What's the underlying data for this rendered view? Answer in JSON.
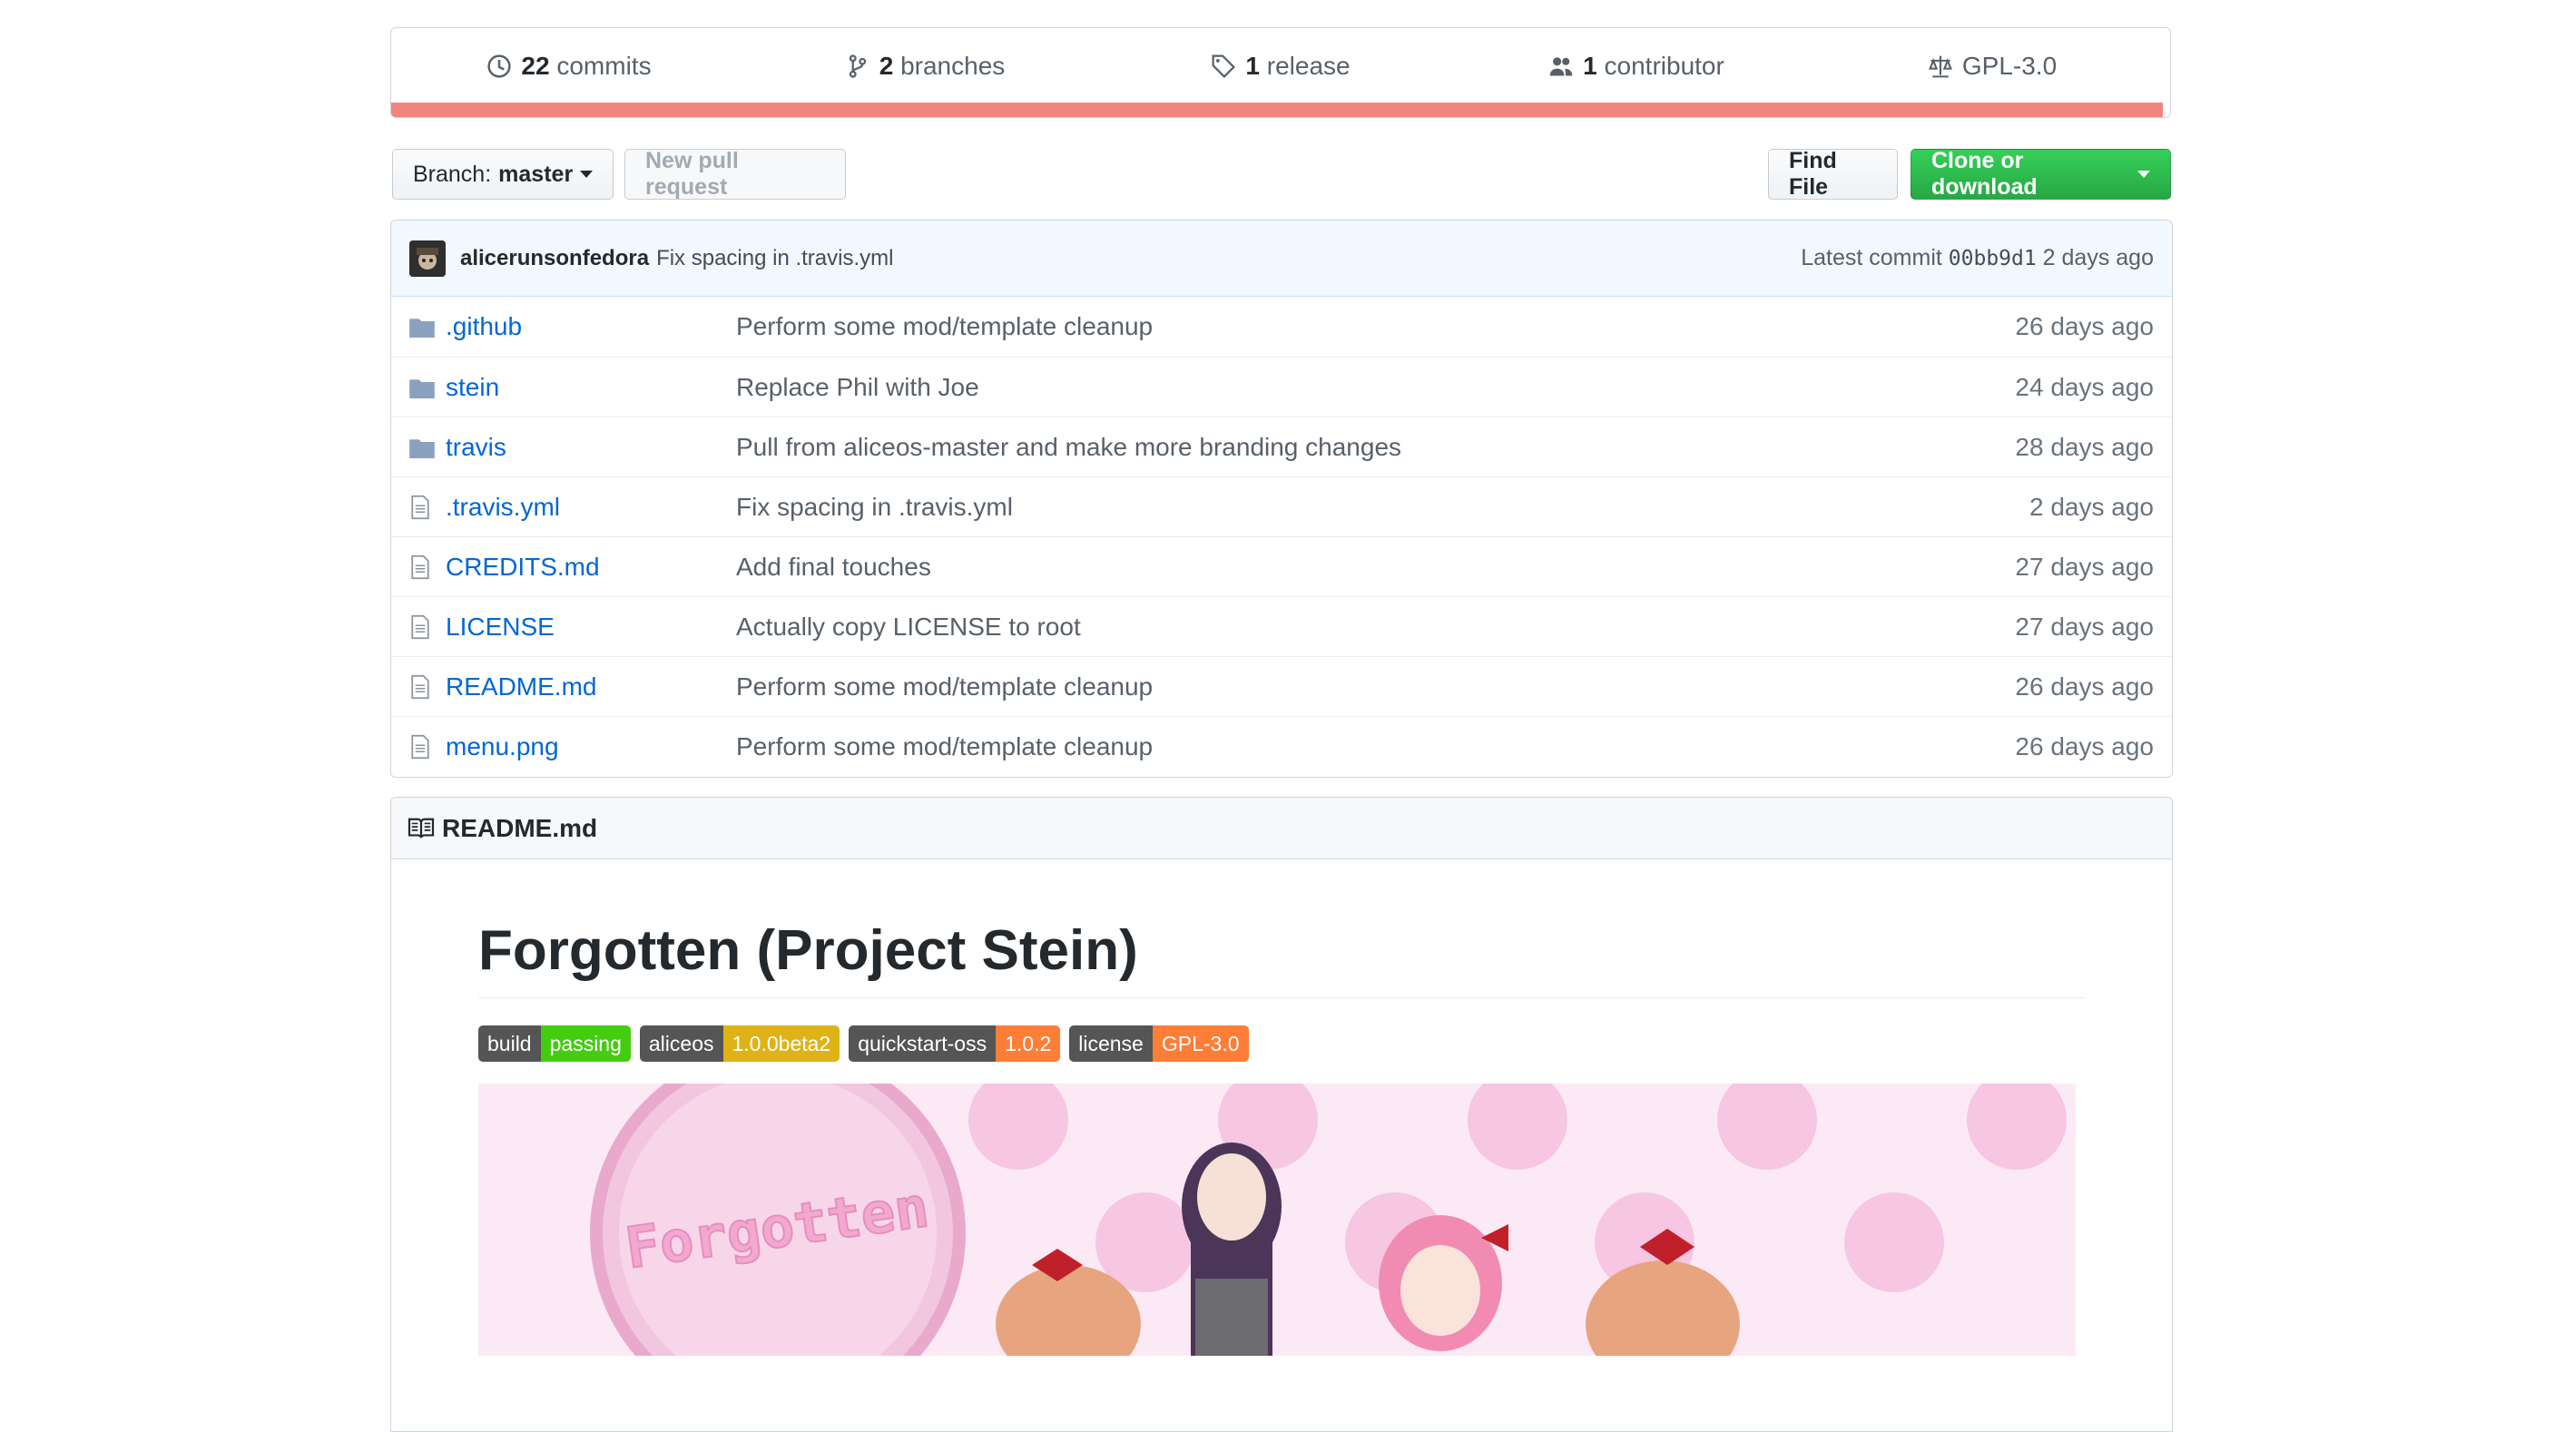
{
  "summary": {
    "commits": {
      "count": "22",
      "label": "commits"
    },
    "branches": {
      "count": "2",
      "label": "branches"
    },
    "releases": {
      "count": "1",
      "label": "release"
    },
    "contributors": {
      "count": "1",
      "label": "contributor"
    },
    "license": {
      "label": "GPL-3.0"
    },
    "language_bar_color": "#f1857d"
  },
  "nav": {
    "branch_prefix": "Branch:",
    "branch_name": "master",
    "new_pr": "New pull request",
    "find_file": "Find File",
    "clone": "Clone or download"
  },
  "latest_commit": {
    "author": "alicerunsonfedora",
    "message": "Fix spacing in .travis.yml",
    "prefix": "Latest commit",
    "sha": "00bb9d1",
    "age": "2 days ago"
  },
  "files": [
    {
      "type": "dir",
      "name": ".github",
      "message": "Perform some mod/template cleanup",
      "age": "26 days ago"
    },
    {
      "type": "dir",
      "name": "stein",
      "message": "Replace Phil with Joe",
      "age": "24 days ago"
    },
    {
      "type": "dir",
      "name": "travis",
      "message": "Pull from aliceos-master and make more branding changes",
      "age": "28 days ago"
    },
    {
      "type": "file",
      "name": ".travis.yml",
      "message": "Fix spacing in .travis.yml",
      "age": "2 days ago"
    },
    {
      "type": "file",
      "name": "CREDITS.md",
      "message": "Add final touches",
      "age": "27 days ago"
    },
    {
      "type": "file",
      "name": "LICENSE",
      "message": "Actually copy LICENSE to root",
      "age": "27 days ago"
    },
    {
      "type": "file",
      "name": "README.md",
      "message": "Perform some mod/template cleanup",
      "age": "26 days ago"
    },
    {
      "type": "file",
      "name": "menu.png",
      "message": "Perform some mod/template cleanup",
      "age": "26 days ago"
    }
  ],
  "readme": {
    "filename": "README.md",
    "title": "Forgotten (Project Stein)",
    "badges": [
      {
        "left": "build",
        "right": "passing",
        "color": "#4c1"
      },
      {
        "left": "aliceos",
        "right": "1.0.0beta2",
        "color": "#dfb317"
      },
      {
        "left": "quickstart-oss",
        "right": "1.0.2",
        "color": "#fe7d37"
      },
      {
        "left": "license",
        "right": "GPL-3.0",
        "color": "#fe7d37"
      }
    ],
    "banner_text": "Forgotten"
  }
}
